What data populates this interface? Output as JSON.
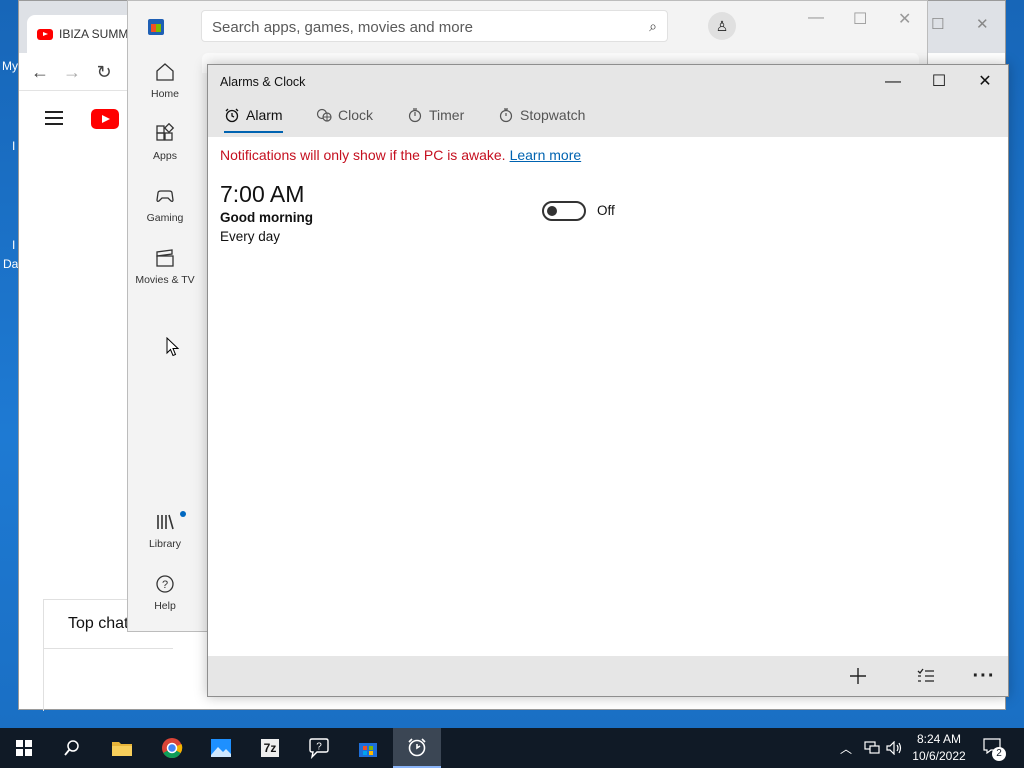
{
  "desktop": {
    "fragments": [
      "My",
      "I",
      "Da"
    ]
  },
  "chrome": {
    "tab_title": "IBIZA SUMM",
    "top_chat_label": "Top chat"
  },
  "store": {
    "search_placeholder": "Search apps, games, movies and more",
    "nav": [
      {
        "label": "Home",
        "icon": "home-icon"
      },
      {
        "label": "Apps",
        "icon": "apps-icon"
      },
      {
        "label": "Gaming",
        "icon": "gamepad-icon"
      },
      {
        "label": "Movies & TV",
        "icon": "clapperboard-icon"
      },
      {
        "label": "Library",
        "icon": "library-icon"
      },
      {
        "label": "Help",
        "icon": "help-icon"
      }
    ]
  },
  "alarms": {
    "title": "Alarms & Clock",
    "tabs": [
      {
        "label": "Alarm",
        "icon": "alarm-icon",
        "active": true
      },
      {
        "label": "Clock",
        "icon": "world-clock-icon",
        "active": false
      },
      {
        "label": "Timer",
        "icon": "timer-icon",
        "active": false
      },
      {
        "label": "Stopwatch",
        "icon": "stopwatch-icon",
        "active": false
      }
    ],
    "notice": "Notifications will only show if the PC is awake.",
    "notice_link": "Learn more",
    "alarm": {
      "time": "7:00 AM",
      "name": "Good morning",
      "repeat": "Every day",
      "enabled": false,
      "state_label": "Off"
    },
    "bottom_actions": [
      {
        "icon": "add-icon"
      },
      {
        "icon": "select-list-icon"
      },
      {
        "icon": "more-icon"
      }
    ],
    "accent_color": "#0063b1",
    "notice_color": "#c50f1f"
  },
  "taskbar": {
    "apps": [
      "start-icon",
      "search-icon",
      "file-explorer-icon",
      "chrome-icon",
      "photos-icon",
      "7zip-icon",
      "help-chat-icon",
      "store-icon",
      "alarms-icon"
    ],
    "app_7zip_label": "7z",
    "time": "8:24 AM",
    "date": "10/6/2022",
    "notification_count": "2"
  }
}
